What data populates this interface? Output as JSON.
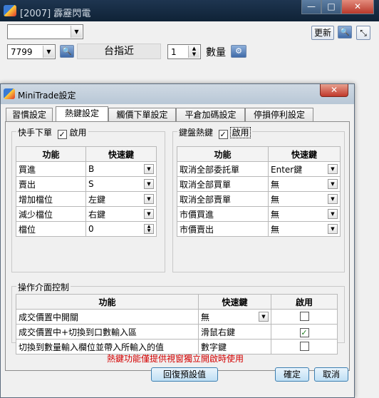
{
  "outer": {
    "title": "[2007] 霹靂閃電",
    "min": "—",
    "max": "□",
    "close": "✕",
    "code": "7799",
    "product": "台指近",
    "qty": "1",
    "qty_label": "數量",
    "update": "更新"
  },
  "dialog": {
    "title": "MiniTrade設定",
    "close": "✕",
    "tabs": [
      "習慣設定",
      "熱鍵設定",
      "觸價下單設定",
      "平倉加碼設定",
      "停損停利設定"
    ],
    "quick_order": {
      "label": "快手下單",
      "enable_label": "啟用",
      "enabled": true,
      "col_func": "功能",
      "col_key": "快速鍵",
      "rows": [
        {
          "func": "買進",
          "key": "B"
        },
        {
          "func": "賣出",
          "key": "S"
        },
        {
          "func": "增加檔位",
          "key": "左鍵"
        },
        {
          "func": "減少檔位",
          "key": "右鍵"
        },
        {
          "func": "檔位",
          "key": "0"
        }
      ]
    },
    "keyboard": {
      "label": "鍵盤熱鍵",
      "enable_label": "啟用",
      "enabled": true,
      "col_func": "功能",
      "col_key": "快速鍵",
      "rows": [
        {
          "func": "取消全部委託單",
          "key": "Enter鍵"
        },
        {
          "func": "取消全部買單",
          "key": "無"
        },
        {
          "func": "取消全部賣單",
          "key": "無"
        },
        {
          "func": "市價買進",
          "key": "無"
        },
        {
          "func": "市價賣出",
          "key": "無"
        }
      ]
    },
    "ui_control": {
      "label": "操作介面控制",
      "col_func": "功能",
      "col_key": "快速鍵",
      "col_enable": "啟用",
      "rows": [
        {
          "func": "成交價置中開關",
          "key": "無",
          "enabled": false
        },
        {
          "func": "成交價置中+切換到口數輸入區",
          "key": "滑鼠右鍵",
          "enabled": true
        },
        {
          "func": "切換到數量輸入欄位並帶入所輸入的值",
          "key": "數字鍵",
          "enabled": false
        }
      ]
    },
    "note": "熱鍵功能僅提供視窗獨立開啟時使用",
    "restore": "回復預設值",
    "ok": "確定",
    "cancel": "取消"
  }
}
